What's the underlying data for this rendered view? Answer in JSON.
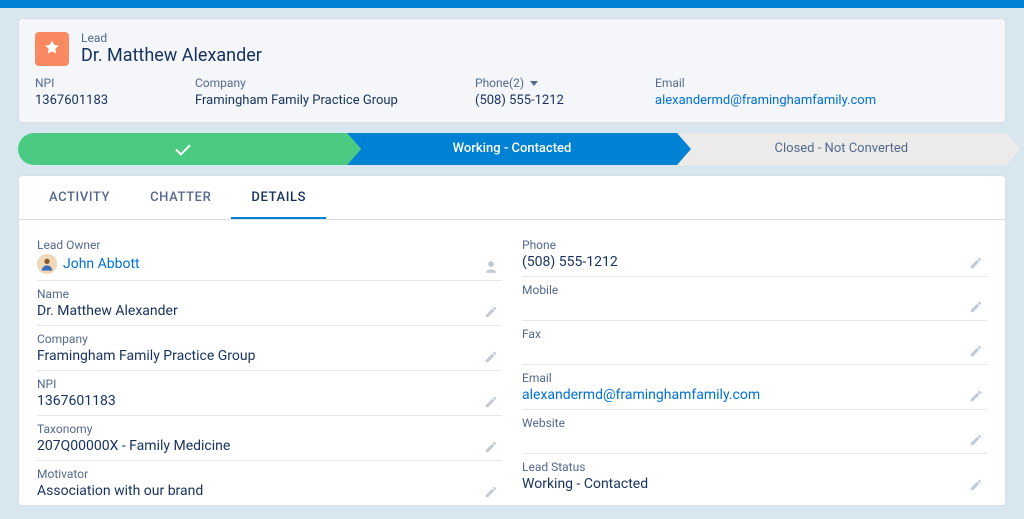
{
  "header": {
    "object_label": "Lead",
    "record_name": "Dr. Matthew Alexander"
  },
  "highlights": {
    "npi_label": "NPI",
    "npi_value": "1367601183",
    "company_label": "Company",
    "company_value": "Framingham Family Practice Group",
    "phone_label": "Phone(2)",
    "phone_value": "(508) 555-1212",
    "email_label": "Email",
    "email_value": "alexandermd@framinghamfamily.com"
  },
  "path": {
    "step2": "Working - Contacted",
    "step3": "Closed - Not Converted"
  },
  "tabs": {
    "activity": "Activity",
    "chatter": "Chatter",
    "details": "Details"
  },
  "details": {
    "left": {
      "lead_owner_label": "Lead Owner",
      "lead_owner_value": "John Abbott",
      "name_label": "Name",
      "name_value": "Dr. Matthew Alexander",
      "company_label": "Company",
      "company_value": "Framingham Family Practice Group",
      "npi_label": "NPI",
      "npi_value": "1367601183",
      "taxonomy_label": "Taxonomy",
      "taxonomy_value": "207Q00000X - Family Medicine",
      "motivator_label": "Motivator",
      "motivator_value": "Association with our brand"
    },
    "right": {
      "phone_label": "Phone",
      "phone_value": "(508) 555-1212",
      "mobile_label": "Mobile",
      "mobile_value": "",
      "fax_label": "Fax",
      "fax_value": "",
      "email_label": "Email",
      "email_value": "alexandermd@framinghamfamily.com",
      "website_label": "Website",
      "website_value": "",
      "lead_status_label": "Lead Status",
      "lead_status_value": "Working - Contacted"
    }
  }
}
